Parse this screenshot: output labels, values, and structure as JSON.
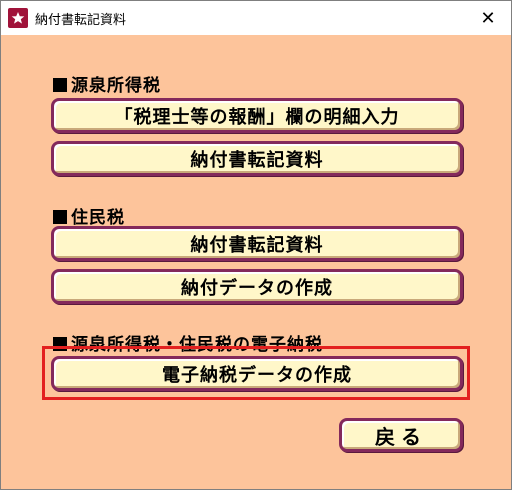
{
  "window": {
    "title": "納付書転記資料",
    "close_glyph": "✕",
    "background_color": "#fdc49b",
    "icon": "app-star-icon"
  },
  "sections": [
    {
      "label": "源泉所得税",
      "buttons": [
        {
          "label": "「税理士等の報酬」欄の明細入力"
        },
        {
          "label": "納付書転記資料"
        }
      ]
    },
    {
      "label": "住民税",
      "buttons": [
        {
          "label": "納付書転記資料"
        },
        {
          "label": "納付データの作成"
        }
      ]
    },
    {
      "label": "源泉所得税・住民税の電子納税",
      "buttons": [
        {
          "label": "電子納税データの作成"
        }
      ]
    }
  ],
  "footer": {
    "back_label": "戻る"
  },
  "colors": {
    "button_face": "#fff7c9",
    "button_border": "#84295b",
    "highlight": "#e3201f"
  }
}
